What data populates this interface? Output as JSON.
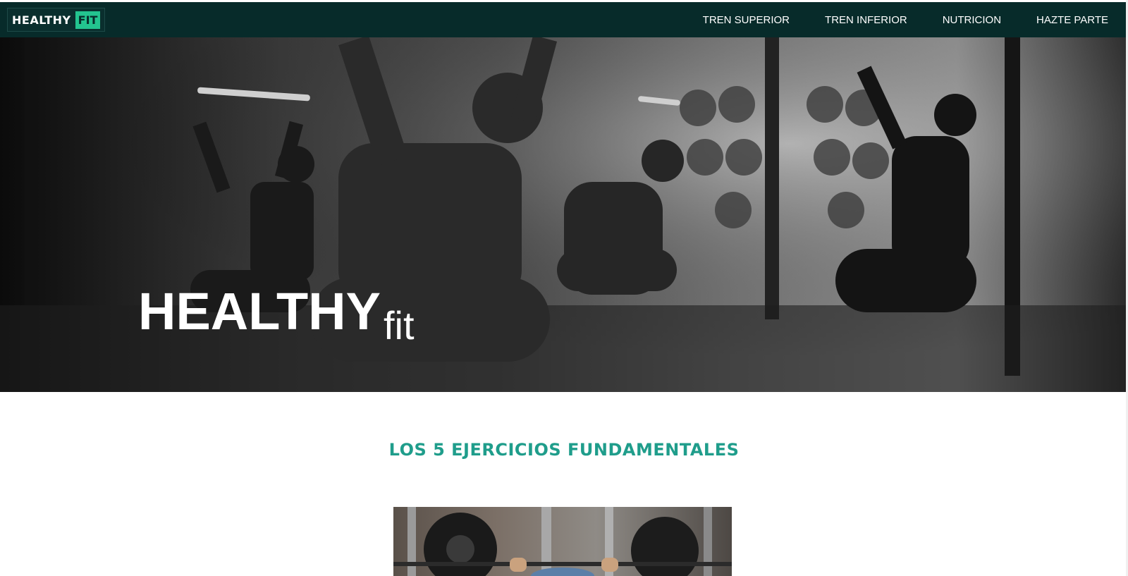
{
  "brand": {
    "name_part1": "HEALTHY",
    "name_part2": "FIT",
    "accent": "#23c48f",
    "nav_bg": "#072b2a"
  },
  "nav": {
    "items": [
      {
        "label": "TREN SUPERIOR"
      },
      {
        "label": "TREN INFERIOR"
      },
      {
        "label": "NUTRICION"
      },
      {
        "label": "HAZTE PARTE"
      }
    ]
  },
  "hero": {
    "title_main": "HEALTHY",
    "title_sub": "fit"
  },
  "section": {
    "title": "LOS 5 EJERCICIOS FUNDAMENTALES",
    "title_color": "#1f9d8b"
  }
}
